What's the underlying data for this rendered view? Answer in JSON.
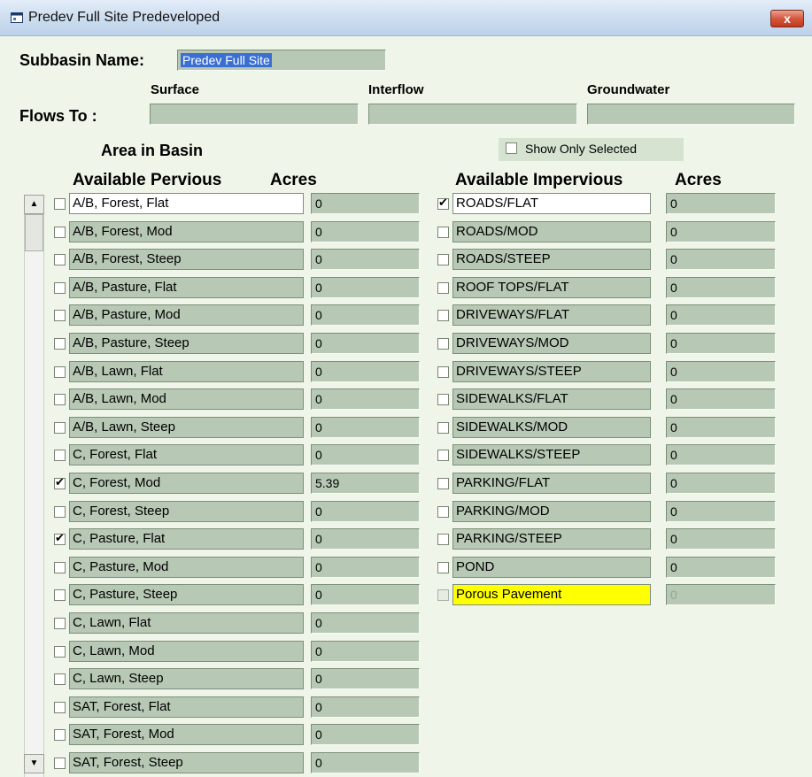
{
  "window": {
    "title": "Predev Full Site Predeveloped",
    "close_label": "x"
  },
  "subbasin": {
    "label": "Subbasin Name:",
    "value": "Predev Full Site"
  },
  "flows": {
    "label": "Flows To :",
    "surface": "Surface",
    "interflow": "Interflow",
    "groundwater": "Groundwater"
  },
  "area_in_basin_label": "Area in Basin",
  "show_only_selected": {
    "label": "Show Only Selected",
    "checked": false
  },
  "pervious": {
    "header": "Available Pervious",
    "acres_header": "Acres",
    "rows": [
      {
        "name": "A/B, Forest, Flat",
        "acres": "0",
        "checked": false
      },
      {
        "name": "A/B, Forest, Mod",
        "acres": "0",
        "checked": false
      },
      {
        "name": "A/B, Forest, Steep",
        "acres": "0",
        "checked": false
      },
      {
        "name": "A/B, Pasture, Flat",
        "acres": "0",
        "checked": false
      },
      {
        "name": "A/B, Pasture, Mod",
        "acres": "0",
        "checked": false
      },
      {
        "name": "A/B, Pasture, Steep",
        "acres": "0",
        "checked": false
      },
      {
        "name": "A/B, Lawn, Flat",
        "acres": "0",
        "checked": false
      },
      {
        "name": "A/B, Lawn, Mod",
        "acres": "0",
        "checked": false
      },
      {
        "name": "A/B, Lawn, Steep",
        "acres": "0",
        "checked": false
      },
      {
        "name": "C, Forest, Flat",
        "acres": "0",
        "checked": false
      },
      {
        "name": "C, Forest, Mod",
        "acres": "5.39",
        "checked": true
      },
      {
        "name": "C, Forest, Steep",
        "acres": "0",
        "checked": false
      },
      {
        "name": "C, Pasture, Flat",
        "acres": "0",
        "checked": true
      },
      {
        "name": "C, Pasture, Mod",
        "acres": "0",
        "checked": false
      },
      {
        "name": "C, Pasture, Steep",
        "acres": "0",
        "checked": false
      },
      {
        "name": "C, Lawn, Flat",
        "acres": "0",
        "checked": false
      },
      {
        "name": "C, Lawn, Mod",
        "acres": "0",
        "checked": false
      },
      {
        "name": "C, Lawn, Steep",
        "acres": "0",
        "checked": false
      },
      {
        "name": "SAT, Forest, Flat",
        "acres": "0",
        "checked": false
      },
      {
        "name": "SAT, Forest, Mod",
        "acres": "0",
        "checked": false
      },
      {
        "name": "SAT, Forest, Steep",
        "acres": "0",
        "checked": false
      }
    ]
  },
  "impervious": {
    "header": "Available Impervious",
    "acres_header": "Acres",
    "rows": [
      {
        "name": "ROADS/FLAT",
        "acres": "0",
        "checked": true
      },
      {
        "name": "ROADS/MOD",
        "acres": "0",
        "checked": false
      },
      {
        "name": "ROADS/STEEP",
        "acres": "0",
        "checked": false
      },
      {
        "name": "ROOF TOPS/FLAT",
        "acres": "0",
        "checked": false
      },
      {
        "name": "DRIVEWAYS/FLAT",
        "acres": "0",
        "checked": false
      },
      {
        "name": "DRIVEWAYS/MOD",
        "acres": "0",
        "checked": false
      },
      {
        "name": "DRIVEWAYS/STEEP",
        "acres": "0",
        "checked": false
      },
      {
        "name": "SIDEWALKS/FLAT",
        "acres": "0",
        "checked": false
      },
      {
        "name": "SIDEWALKS/MOD",
        "acres": "0",
        "checked": false
      },
      {
        "name": "SIDEWALKS/STEEP",
        "acres": "0",
        "checked": false
      },
      {
        "name": "PARKING/FLAT",
        "acres": "0",
        "checked": false
      },
      {
        "name": "PARKING/MOD",
        "acres": "0",
        "checked": false
      },
      {
        "name": "PARKING/STEEP",
        "acres": "0",
        "checked": false
      },
      {
        "name": "POND",
        "acres": "0",
        "checked": false
      },
      {
        "name": "Porous Pavement",
        "acres": "0",
        "checked": false,
        "highlight": true,
        "disabled": true
      }
    ]
  }
}
